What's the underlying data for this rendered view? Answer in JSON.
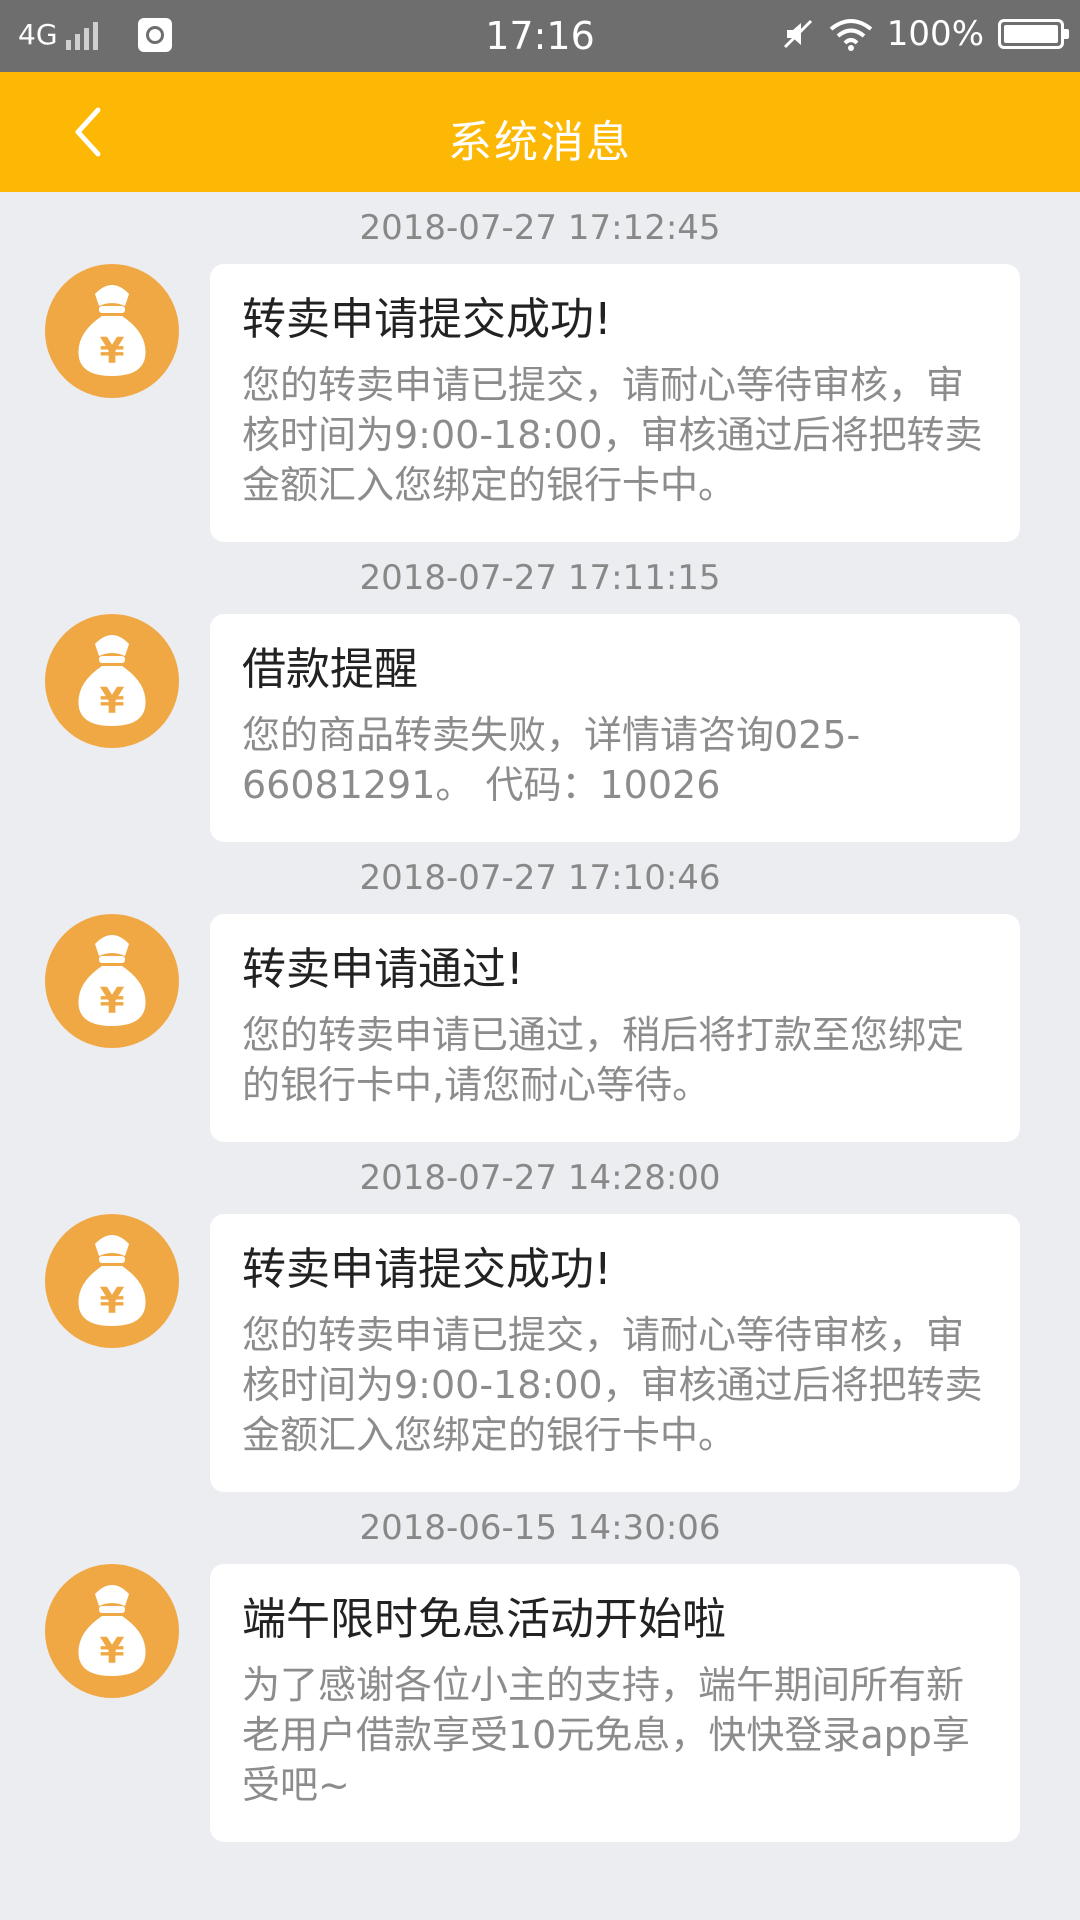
{
  "status_bar": {
    "network": "4G",
    "time": "17:16",
    "battery": "100%"
  },
  "header": {
    "title": "系统消息"
  },
  "messages": [
    {
      "time": "2018-07-27 17:12:45",
      "title": "转卖申请提交成功!",
      "body": "您的转卖申请已提交，请耐心等待审核，审核时间为9:00-18:00，审核通过后将把转卖金额汇入您绑定的银行卡中。"
    },
    {
      "time": "2018-07-27 17:11:15",
      "title": "借款提醒",
      "body": "您的商品转卖失败，详情请咨询025-66081291。 代码：10026"
    },
    {
      "time": "2018-07-27 17:10:46",
      "title": "转卖申请通过!",
      "body": "您的转卖申请已通过，稍后将打款至您绑定的银行卡中,请您耐心等待。"
    },
    {
      "time": "2018-07-27 14:28:00",
      "title": "转卖申请提交成功!",
      "body": "您的转卖申请已提交，请耐心等待审核，审核时间为9:00-18:00，审核通过后将把转卖金额汇入您绑定的银行卡中。"
    },
    {
      "time": "2018-06-15 14:30:06",
      "title": "端午限时免息活动开始啦",
      "body": "为了感谢各位小主的支持，端午期间所有新老用户借款享受10元免息，快快登录app享受吧~"
    }
  ],
  "colors": {
    "header_bg": "#fdb805",
    "avatar_bg": "#f0a845",
    "page_bg": "#ecedf1"
  },
  "icons": {
    "back": "chevron-left-icon",
    "avatar": "money-bag-icon"
  }
}
